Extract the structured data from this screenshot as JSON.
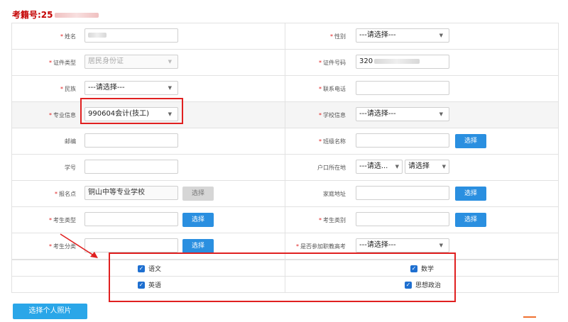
{
  "header": {
    "exam_no_label": "考籍号:25"
  },
  "form": {
    "name_label": "姓名",
    "gender_label": "性别",
    "gender_value": "---请选择---",
    "id_type_label": "证件类型",
    "id_type_value": "居民身份证",
    "id_no_label": "证件号码",
    "id_no_value": "320",
    "ethnicity_label": "民族",
    "ethnicity_value": "---请选择---",
    "phone_label": "联系电话",
    "major_label": "专业信息",
    "major_value": "990604会计(技工)",
    "school_label": "学校信息",
    "school_value": "---请选择---",
    "postcode_label": "邮编",
    "class_label": "班级名称",
    "class_button": "选择",
    "student_no_label": "学号",
    "hukou_label": "户口所在地",
    "hukou_value1": "---请选...",
    "hukou_value2": "请选择",
    "signup_label": "报名点",
    "signup_value": "铜山中等专业学校",
    "signup_button": "选择",
    "address_label": "家庭地址",
    "address_button": "选择",
    "cand_type_label": "考生类型",
    "cand_type_button": "选择",
    "cand_category_label": "考生类别",
    "cand_category_button": "选择",
    "cand_class_label": "考生分类",
    "cand_class_button": "选择",
    "vocational_label": "是否参加职教高考",
    "vocational_value": "---请选择---"
  },
  "subjects": [
    "语文",
    "数学",
    "英语",
    "思想政治"
  ],
  "photo_button": "选择个人照片",
  "colors": {
    "accent": "#2a8fe0",
    "required": "#e02020",
    "highlight": "#e02020"
  }
}
